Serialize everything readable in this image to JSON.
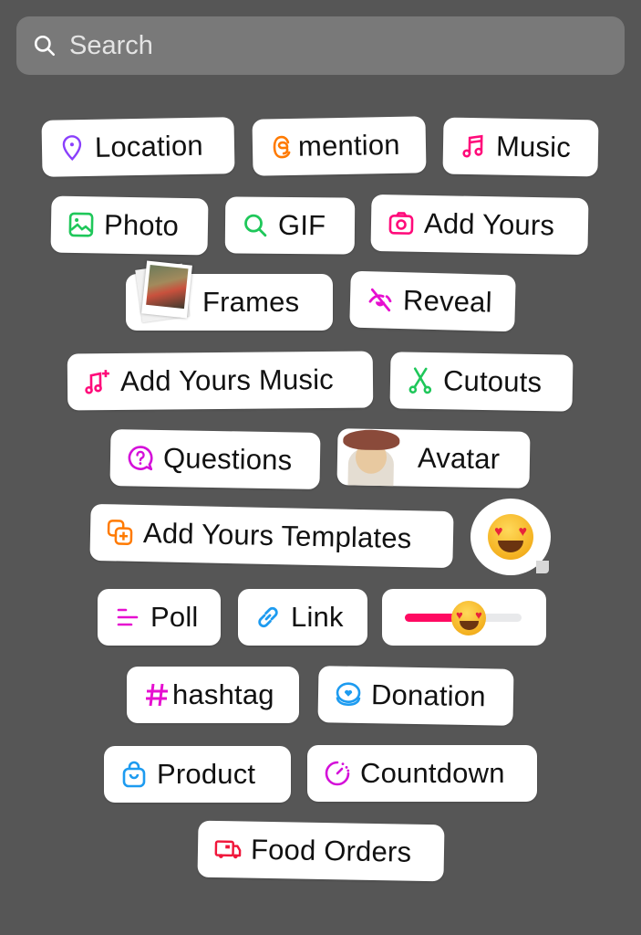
{
  "search": {
    "placeholder": "Search",
    "value": ""
  },
  "stickers": {
    "location": "Location",
    "mention": "mention",
    "music": "Music",
    "photo": "Photo",
    "gif": "GIF",
    "add_yours": "Add Yours",
    "frames": "Frames",
    "reveal": "Reveal",
    "add_yours_music": "Add Yours Music",
    "cutouts": "Cutouts",
    "questions": "Questions",
    "avatar": "Avatar",
    "add_yours_templates": "Add Yours Templates",
    "poll": "Poll",
    "link": "Link",
    "hashtag": "hashtag",
    "donation": "Donation",
    "product": "Product",
    "countdown": "Countdown",
    "food_orders": "Food Orders"
  },
  "emoji_slider": {
    "value_fraction": 0.55,
    "emoji": "heart-eyes-face"
  },
  "colors": {
    "background": "#565656",
    "location": "#8a3ffc",
    "mention": "#ff7a00",
    "music": "#ff0a7a",
    "photo": "#1fc75a",
    "gif": "#1fc75a",
    "add_yours": "#ff0a7a",
    "reveal": "#e60fd0",
    "cutouts": "#1fc75a",
    "questions": "#d40fd9",
    "templates": "#ff7a00",
    "poll": "#e60fd0",
    "link": "#1d9bf0",
    "hashtag": "#e60fd0",
    "donation": "#1d9bf0",
    "product": "#1d9bf0",
    "countdown": "#d40fd9",
    "food_orders": "#f0163a",
    "slider_fill": "#ff0a62"
  }
}
